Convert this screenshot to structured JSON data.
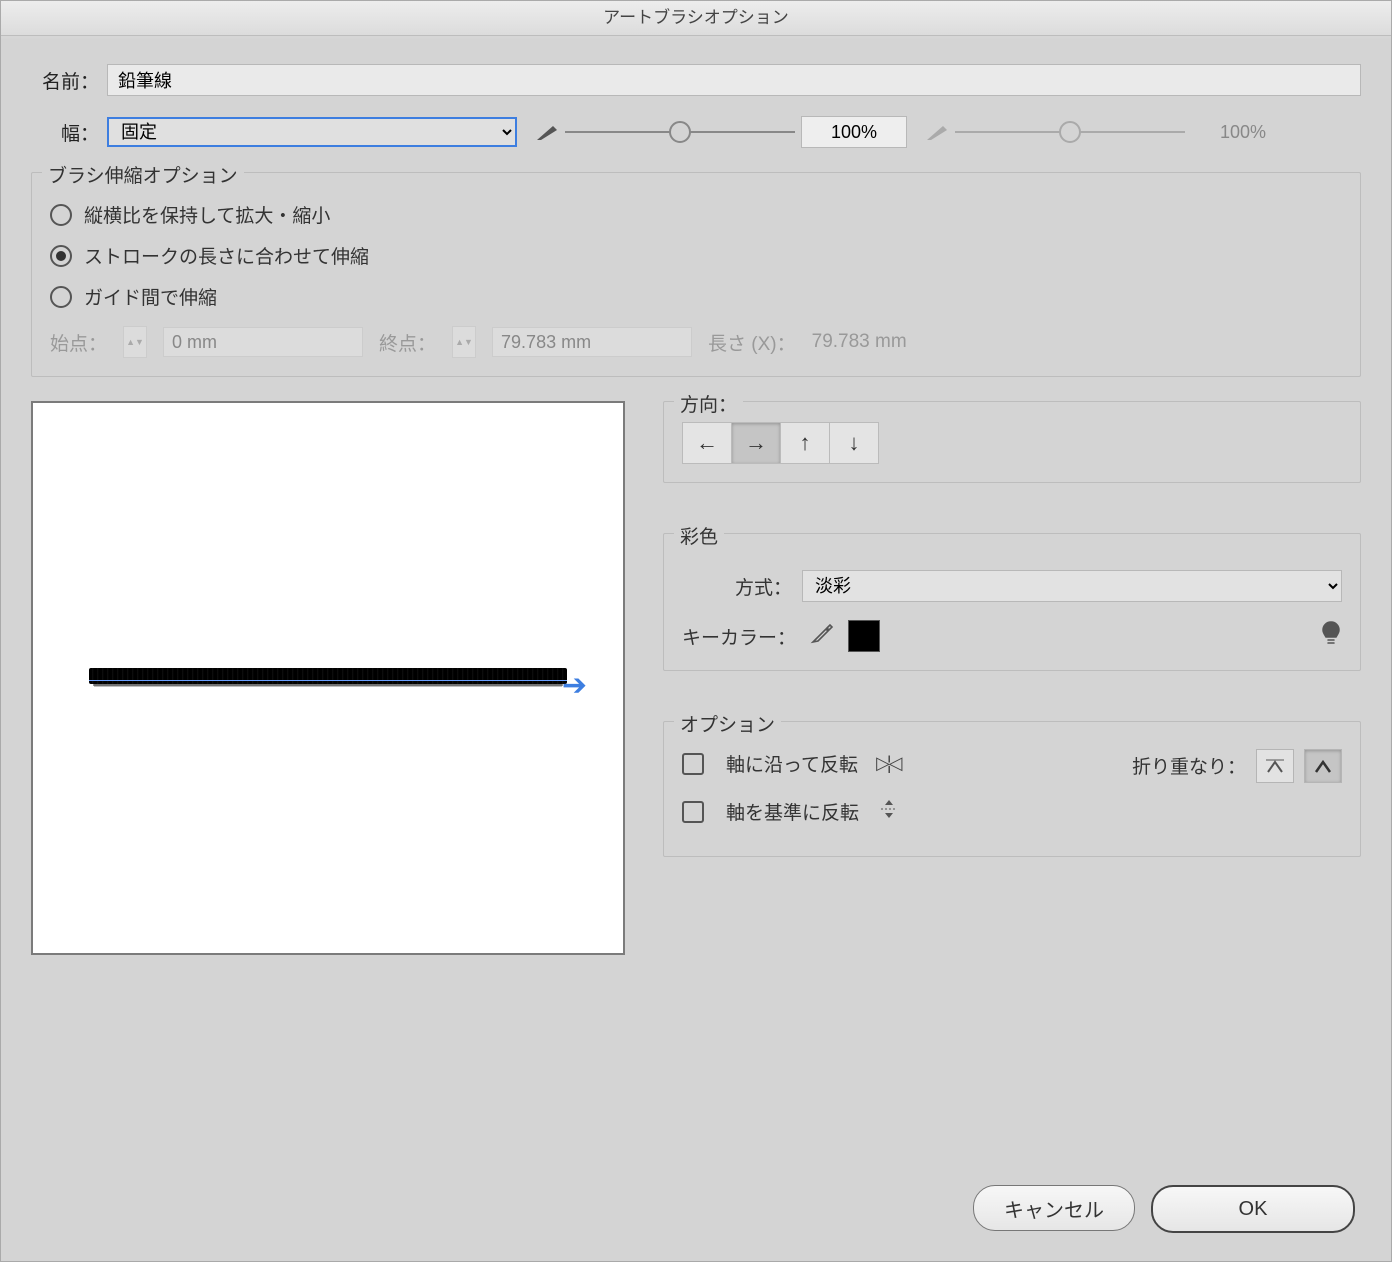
{
  "dialog": {
    "title": "アートブラシオプション"
  },
  "name": {
    "label": "名前：",
    "value": "鉛筆線"
  },
  "width": {
    "label": "幅：",
    "mode": "固定",
    "slider1_pos_pct": 50,
    "value1": "100%",
    "slider2_pos_pct": 50,
    "value2": "100%"
  },
  "scale": {
    "legend": "ブラシ伸縮オプション",
    "radios": {
      "proportional": "縦横比を保持して拡大・縮小",
      "stretch": "ストロークの長さに合わせて伸縮",
      "between_guides": "ガイド間で伸縮"
    },
    "selected": "stretch",
    "start_label": "始点：",
    "start_value": "0 mm",
    "end_label": "終点：",
    "end_value": "79.783 mm",
    "length_label": "長さ (X)：",
    "length_value": "79.783 mm"
  },
  "direction": {
    "legend": "方向："
  },
  "color": {
    "legend": "彩色",
    "method_label": "方式：",
    "method_value": "淡彩",
    "key_label": "キーカラー：",
    "swatch": "#000000"
  },
  "options": {
    "legend": "オプション",
    "flip_along": "軸に沿って反転",
    "flip_across": "軸を基準に反転",
    "overlap_label": "折り重なり："
  },
  "footer": {
    "cancel": "キャンセル",
    "ok": "OK"
  }
}
